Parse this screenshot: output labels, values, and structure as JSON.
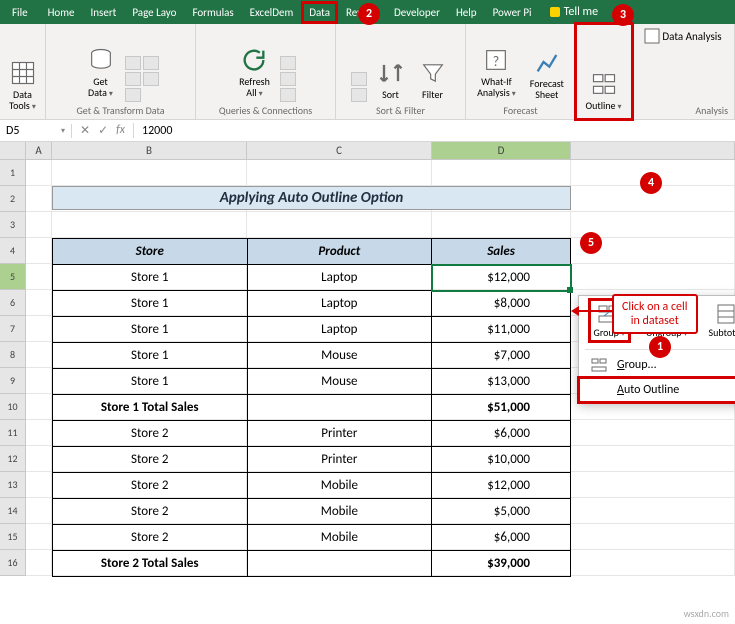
{
  "tabs": {
    "file": "File",
    "home": "Home",
    "insert": "Insert",
    "pagelay": "Page Layo",
    "formulas": "Formulas",
    "exceldem": "ExcelDem",
    "data": "Data",
    "review": "Review",
    "developer": "Developer",
    "help": "Help",
    "powerpi": "Power Pi",
    "tellme": "Tell me"
  },
  "ribbon": {
    "datatools": "Data\nTools",
    "getdata": "Get\nData",
    "gettransform": "Get & Transform Data",
    "refreshall": "Refresh\nAll",
    "queries": "Queries & Connections",
    "sort": "Sort",
    "filter": "Filter",
    "sortfilter": "Sort & Filter",
    "whatif": "What-If\nAnalysis",
    "forecastsheet": "Forecast\nSheet",
    "forecast": "Forecast",
    "outline": "Outline",
    "dataanalysis": "Data Analysis",
    "analysis": "Analysis"
  },
  "pop": {
    "group": "Group",
    "ungroup": "Ungroup",
    "subtotal": "Subtotal",
    "menu_group": "Group...",
    "menu_auto": "Auto Outline"
  },
  "fbar": {
    "name": "D5",
    "cancel": "✕",
    "enter": "✓",
    "fx": "fx",
    "value": "12000"
  },
  "cols": {
    "A": "A",
    "B": "B",
    "C": "C",
    "D": "D"
  },
  "rows": [
    "1",
    "2",
    "3",
    "4",
    "5",
    "6",
    "7",
    "8",
    "9",
    "10",
    "11",
    "12",
    "13",
    "14",
    "15",
    "16"
  ],
  "title": "Applying Auto Outline Option",
  "headers": {
    "store": "Store",
    "product": "Product",
    "sales": "Sales"
  },
  "data": [
    {
      "store": "Store 1",
      "product": "Laptop",
      "sales": "$12,000"
    },
    {
      "store": "Store 1",
      "product": "Laptop",
      "sales": "$8,000"
    },
    {
      "store": "Store 1",
      "product": "Laptop",
      "sales": "$11,000"
    },
    {
      "store": "Store 1",
      "product": "Mouse",
      "sales": "$7,000"
    },
    {
      "store": "Store 1",
      "product": "Mouse",
      "sales": "$13,000"
    },
    {
      "store": "Store 1 Total Sales",
      "product": "",
      "sales": "$51,000",
      "total": true
    },
    {
      "store": "Store 2",
      "product": "Printer",
      "sales": "$6,000"
    },
    {
      "store": "Store 2",
      "product": "Printer",
      "sales": "$10,000"
    },
    {
      "store": "Store 2",
      "product": "Mobile",
      "sales": "$12,000"
    },
    {
      "store": "Store 2",
      "product": "Mobile",
      "sales": "$5,000"
    },
    {
      "store": "Store 2",
      "product": "Mobile",
      "sales": "$6,000"
    },
    {
      "store": "Store 2 Total Sales",
      "product": "",
      "sales": "$39,000",
      "total": true
    }
  ],
  "callout": {
    "text": "Click on a cell\nin dataset"
  },
  "badges": {
    "b1": "1",
    "b2": "2",
    "b3": "3",
    "b4": "4",
    "b5": "5"
  },
  "watermark": "wsxdn.com"
}
